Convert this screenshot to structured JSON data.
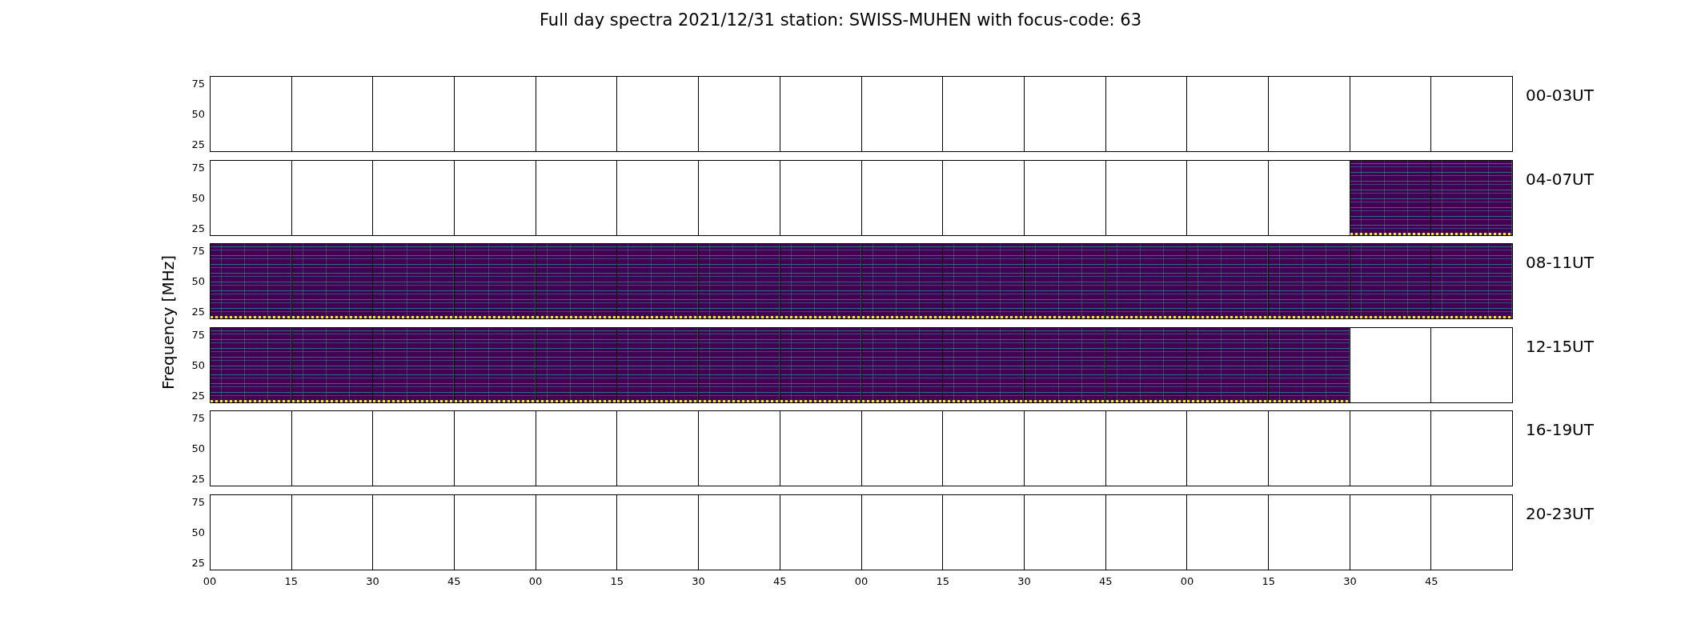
{
  "title": "Full day spectra 2021/12/31 station: SWISS-MUHEN with focus-code: 63",
  "y_axis_label": "Frequency [MHz]",
  "rows": [
    {
      "label": "00-03UT",
      "y_ticks": [
        "75",
        "50",
        "25"
      ],
      "panels": [
        {
          "has_data": false
        },
        {
          "has_data": false
        },
        {
          "has_data": false
        },
        {
          "has_data": false
        },
        {
          "has_data": false
        },
        {
          "has_data": false
        },
        {
          "has_data": false
        },
        {
          "has_data": false
        },
        {
          "has_data": false
        },
        {
          "has_data": false
        },
        {
          "has_data": false
        },
        {
          "has_data": false
        },
        {
          "has_data": false
        },
        {
          "has_data": false
        },
        {
          "has_data": false
        },
        {
          "has_data": false
        }
      ]
    },
    {
      "label": "04-07UT",
      "y_ticks": [
        "75",
        "50",
        "25"
      ],
      "panels": [
        {
          "has_data": false
        },
        {
          "has_data": false
        },
        {
          "has_data": false
        },
        {
          "has_data": false
        },
        {
          "has_data": false
        },
        {
          "has_data": false
        },
        {
          "has_data": false
        },
        {
          "has_data": false
        },
        {
          "has_data": false
        },
        {
          "has_data": false
        },
        {
          "has_data": false
        },
        {
          "has_data": false
        },
        {
          "has_data": false
        },
        {
          "has_data": false
        },
        {
          "has_data": true
        },
        {
          "has_data": true
        }
      ]
    },
    {
      "label": "08-11UT",
      "y_ticks": [
        "75",
        "50",
        "25"
      ],
      "panels": [
        {
          "has_data": true
        },
        {
          "has_data": true
        },
        {
          "has_data": true
        },
        {
          "has_data": true
        },
        {
          "has_data": true
        },
        {
          "has_data": true
        },
        {
          "has_data": true
        },
        {
          "has_data": true
        },
        {
          "has_data": true
        },
        {
          "has_data": true
        },
        {
          "has_data": true
        },
        {
          "has_data": true
        },
        {
          "has_data": true
        },
        {
          "has_data": true
        },
        {
          "has_data": true
        },
        {
          "has_data": true
        }
      ]
    },
    {
      "label": "12-15UT",
      "y_ticks": [
        "75",
        "50",
        "25"
      ],
      "panels": [
        {
          "has_data": true
        },
        {
          "has_data": true
        },
        {
          "has_data": true
        },
        {
          "has_data": true
        },
        {
          "has_data": true
        },
        {
          "has_data": true
        },
        {
          "has_data": true
        },
        {
          "has_data": true
        },
        {
          "has_data": true
        },
        {
          "has_data": true
        },
        {
          "has_data": true
        },
        {
          "has_data": true
        },
        {
          "has_data": true
        },
        {
          "has_data": true
        },
        {
          "has_data": false
        },
        {
          "has_data": false
        }
      ]
    },
    {
      "label": "16-19UT",
      "y_ticks": [
        "75",
        "50",
        "25"
      ],
      "panels": [
        {
          "has_data": false
        },
        {
          "has_data": false
        },
        {
          "has_data": false
        },
        {
          "has_data": false
        },
        {
          "has_data": false
        },
        {
          "has_data": false
        },
        {
          "has_data": false
        },
        {
          "has_data": false
        },
        {
          "has_data": false
        },
        {
          "has_data": false
        },
        {
          "has_data": false
        },
        {
          "has_data": false
        },
        {
          "has_data": false
        },
        {
          "has_data": false
        },
        {
          "has_data": false
        },
        {
          "has_data": false
        }
      ]
    },
    {
      "label": "20-23UT",
      "y_ticks": [
        "75",
        "50",
        "25"
      ],
      "panels": [
        {
          "has_data": false
        },
        {
          "has_data": false
        },
        {
          "has_data": false
        },
        {
          "has_data": false
        },
        {
          "has_data": false
        },
        {
          "has_data": false
        },
        {
          "has_data": false
        },
        {
          "has_data": false
        },
        {
          "has_data": false
        },
        {
          "has_data": false
        },
        {
          "has_data": false
        },
        {
          "has_data": false
        },
        {
          "has_data": false
        },
        {
          "has_data": false
        },
        {
          "has_data": false
        },
        {
          "has_data": false
        }
      ]
    }
  ],
  "x_ticks": [
    "00",
    "15",
    "30",
    "45",
    "00",
    "15",
    "30",
    "45",
    "00",
    "15",
    "30",
    "45",
    "00",
    "15",
    "30",
    "45"
  ]
}
